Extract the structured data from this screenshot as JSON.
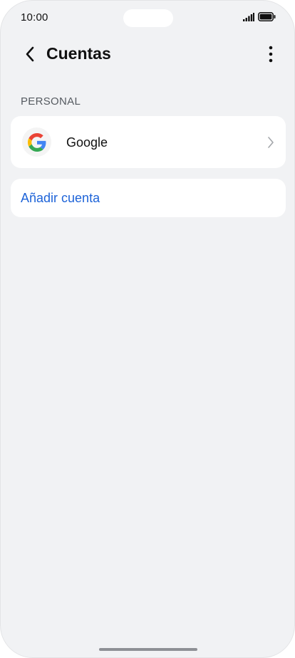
{
  "status_bar": {
    "time": "10:00",
    "signal_icon": "signal-icon",
    "battery_icon": "battery-icon"
  },
  "app_bar": {
    "back_icon": "back-arrow-icon",
    "title": "Cuentas",
    "more_icon": "more-vertical-icon"
  },
  "sections": [
    {
      "label": "PERSONAL",
      "accounts": [
        {
          "name": "Google",
          "icon": "google-logo-icon",
          "chevron_icon": "chevron-right-icon"
        }
      ]
    }
  ],
  "add_account": {
    "label": "Añadir cuenta"
  },
  "colors": {
    "background": "#f1f2f4",
    "card": "#ffffff",
    "accent": "#1d63d8",
    "text_primary": "#111111",
    "text_secondary": "#555a60"
  }
}
